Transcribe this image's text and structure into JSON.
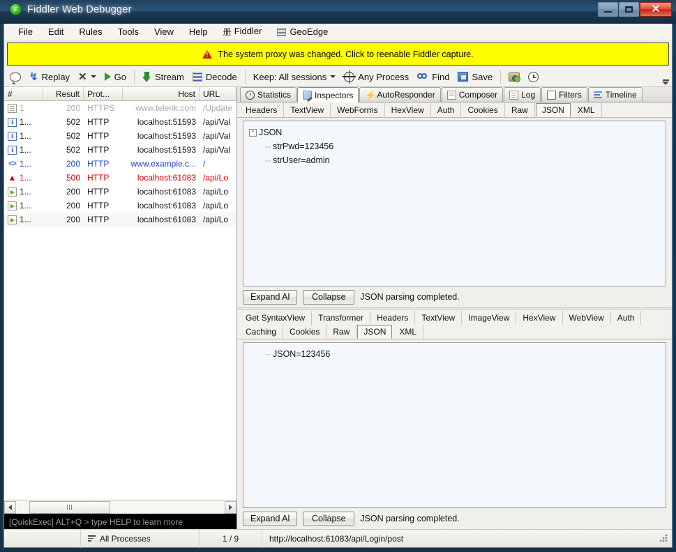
{
  "window": {
    "title": "Fiddler Web Debugger",
    "app_icon": "fiddler-icon",
    "minimize_label": "Minimize",
    "maximize_label": "Maximize",
    "close_label": "Close"
  },
  "menubar": {
    "items": [
      {
        "label": "File",
        "icon": null
      },
      {
        "label": "Edit",
        "icon": null
      },
      {
        "label": "Rules",
        "icon": null
      },
      {
        "label": "Tools",
        "icon": null
      },
      {
        "label": "View",
        "icon": null
      },
      {
        "label": "Help",
        "icon": null
      },
      {
        "label": "Fiddler",
        "icon": "fiddler-glyph",
        "glyph": "册"
      },
      {
        "label": "GeoEdge",
        "icon": "geoedge-icon"
      }
    ]
  },
  "notification": {
    "icon": "warning-icon",
    "text": "The system proxy was changed. Click to reenable Fiddler capture.",
    "background": "#ffff00"
  },
  "toolbar": {
    "comment_label": "",
    "replay_label": "Replay",
    "remove_label": "",
    "go_label": "Go",
    "stream_label": "Stream",
    "decode_label": "Decode",
    "keep_label": "Keep: All sessions",
    "process_label": "Any Process",
    "find_label": "Find",
    "save_label": "Save",
    "capture_label": "",
    "timer_label": ""
  },
  "sessions": {
    "columns": [
      "#",
      "Result",
      "Prot...",
      "Host",
      "URL"
    ],
    "rows": [
      {
        "icon": "document-icon",
        "num": "1",
        "result": "200",
        "protocol": "HTTPS",
        "host": "www.telerik.com",
        "url": "/Update",
        "style": "dim"
      },
      {
        "icon": "info-icon",
        "num": "1...",
        "result": "502",
        "protocol": "HTTP",
        "host": "localhost:51593",
        "url": "/api/Val",
        "style": "normal"
      },
      {
        "icon": "info-icon",
        "num": "1...",
        "result": "502",
        "protocol": "HTTP",
        "host": "localhost:51593",
        "url": "/api/Val",
        "style": "normal"
      },
      {
        "icon": "info-icon",
        "num": "1...",
        "result": "502",
        "protocol": "HTTP",
        "host": "localhost:51593",
        "url": "/api/Val",
        "style": "normal"
      },
      {
        "icon": "code-icon",
        "num": "1...",
        "result": "200",
        "protocol": "HTTP",
        "host": "www.example.c...",
        "url": "/",
        "style": "blue"
      },
      {
        "icon": "error-icon",
        "num": "1...",
        "result": "500",
        "protocol": "HTTP",
        "host": "localhost:61083",
        "url": "/api/Lo",
        "style": "red"
      },
      {
        "icon": "arrow-icon",
        "num": "1...",
        "result": "200",
        "protocol": "HTTP",
        "host": "localhost:61083",
        "url": "/api/Lo",
        "style": "normal"
      },
      {
        "icon": "arrow-icon",
        "num": "1...",
        "result": "200",
        "protocol": "HTTP",
        "host": "localhost:61083",
        "url": "/api/Lo",
        "style": "normal"
      },
      {
        "icon": "arrow-icon",
        "num": "1...",
        "result": "200",
        "protocol": "HTTP",
        "host": "localhost:61083",
        "url": "/api/Lo",
        "style": "alt"
      }
    ]
  },
  "quickexec": {
    "placeholder": "[QuickExec] ALT+Q > type HELP to learn more"
  },
  "inspector": {
    "main_tabs": [
      {
        "label": "Statistics",
        "icon": "stopwatch-icon",
        "active": false
      },
      {
        "label": "Inspectors",
        "icon": "magnifier-icon",
        "active": true
      },
      {
        "label": "AutoResponder",
        "icon": "lightning-icon",
        "active": false
      },
      {
        "label": "Composer",
        "icon": "compose-icon",
        "active": false
      },
      {
        "label": "Log",
        "icon": "log-icon",
        "active": false
      },
      {
        "label": "Filters",
        "icon": "filter-icon",
        "active": false
      },
      {
        "label": "Timeline",
        "icon": "timeline-icon",
        "active": false
      }
    ],
    "request": {
      "tabs": [
        {
          "label": "Headers",
          "active": false
        },
        {
          "label": "TextView",
          "active": false
        },
        {
          "label": "WebForms",
          "active": false
        },
        {
          "label": "HexView",
          "active": false
        },
        {
          "label": "Auth",
          "active": false
        },
        {
          "label": "Cookies",
          "active": false
        },
        {
          "label": "Raw",
          "active": false
        },
        {
          "label": "JSON",
          "active": true
        },
        {
          "label": "XML",
          "active": false
        }
      ],
      "tree": [
        {
          "level": 0,
          "expander": "-",
          "text": "JSON"
        },
        {
          "level": 1,
          "expander": null,
          "text": "strPwd=123456"
        },
        {
          "level": 1,
          "expander": null,
          "text": "strUser=admin"
        }
      ],
      "expand_button": "Expand Al",
      "collapse_button": "Collapse",
      "status": "JSON parsing completed."
    },
    "response": {
      "tabs": [
        {
          "label": "Get SyntaxView",
          "active": false
        },
        {
          "label": "Transformer",
          "active": false
        },
        {
          "label": "Headers",
          "active": false
        },
        {
          "label": "TextView",
          "active": false
        },
        {
          "label": "ImageView",
          "active": false
        },
        {
          "label": "HexView",
          "active": false
        },
        {
          "label": "WebView",
          "active": false
        },
        {
          "label": "Auth",
          "active": false
        },
        {
          "label": "Caching",
          "active": false
        },
        {
          "label": "Cookies",
          "active": false
        },
        {
          "label": "Raw",
          "active": false
        },
        {
          "label": "JSON",
          "active": true
        },
        {
          "label": "XML",
          "active": false
        }
      ],
      "tree": [
        {
          "level": 1,
          "expander": null,
          "text": "JSON=123456"
        }
      ],
      "expand_button": "Expand Al",
      "collapse_button": "Collapse",
      "status": "JSON parsing completed."
    }
  },
  "statusbar": {
    "processes_label": "All Processes",
    "counter": "1 / 9",
    "url": "http://localhost:61083/api/Login/post"
  }
}
